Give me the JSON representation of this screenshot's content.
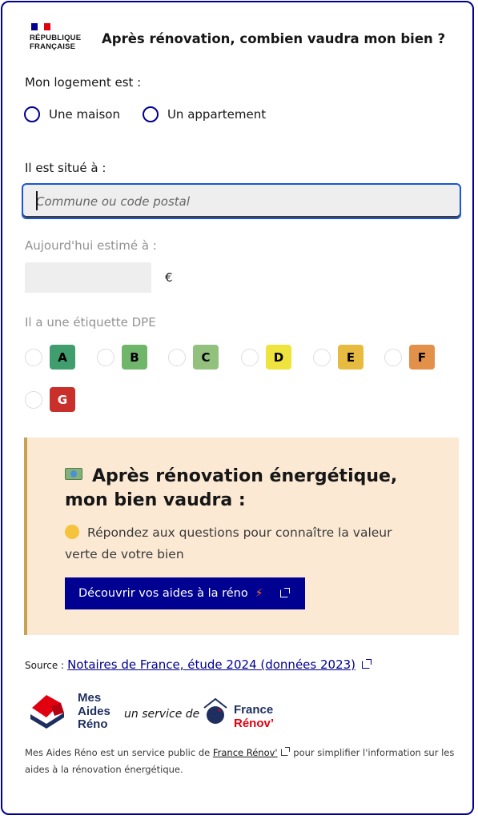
{
  "header": {
    "logo_text": "RÉPUBLIQUE\nFRANÇAISE",
    "title": "Après rénovation, combien vaudra mon bien ?"
  },
  "housing": {
    "label": "Mon logement est :",
    "options": [
      "Une maison",
      "Un appartement"
    ]
  },
  "location": {
    "label": "Il est situé à :",
    "placeholder": "Commune ou code postal"
  },
  "estimate": {
    "label": "Aujourd'hui estimé à :",
    "value": "",
    "currency": "€"
  },
  "dpe": {
    "label": "Il a une étiquette DPE",
    "classes": [
      {
        "letter": "A",
        "color": "#3f9d6e"
      },
      {
        "letter": "B",
        "color": "#6fb66a"
      },
      {
        "letter": "C",
        "color": "#92c17d"
      },
      {
        "letter": "D",
        "color": "#efe43d"
      },
      {
        "letter": "E",
        "color": "#e7bb3f"
      },
      {
        "letter": "F",
        "color": "#e2904a"
      },
      {
        "letter": "G",
        "color": "#c9302c"
      }
    ]
  },
  "callout": {
    "title": "Après rénovation énergétique, mon bien vaudra :",
    "text": "Répondez aux questions pour connaître la valeur verte de votre bien",
    "cta_label": "Découvrir vos aides à la réno",
    "icon_title": "money-icon",
    "icon_text": "thinking-face-icon"
  },
  "source": {
    "prefix": "Source :",
    "link": "Notaires de France, étude 2024 (données 2023)"
  },
  "branding": {
    "mar_text": "Mes\nAides\nRéno",
    "service": "un service de",
    "fr_line1": "France",
    "fr_line2": "Rénov’"
  },
  "footnote": {
    "before": "Mes Aides Réno est un service public de",
    "link": "France Rénov'",
    "after": "pour simplifier l'information sur les aides à la rénovation énergétique."
  },
  "colors": {
    "primary": "#000091",
    "callout_bg": "#fbe9d4",
    "callout_border": "#c8a254",
    "marianne_red": "#e1000f"
  }
}
